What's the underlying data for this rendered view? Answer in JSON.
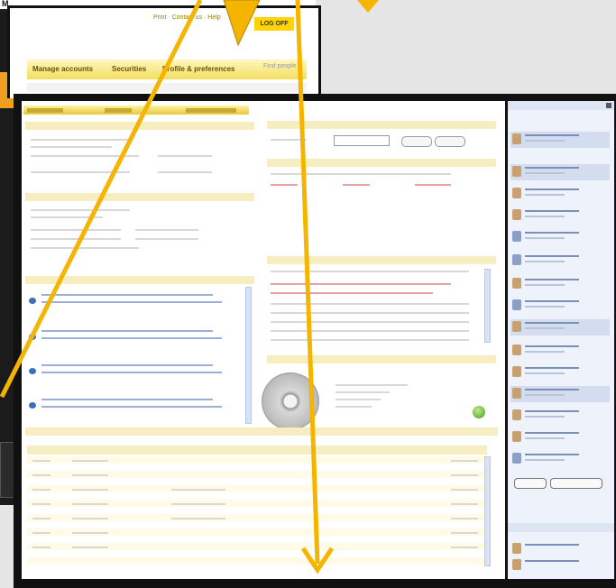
{
  "back_window": {
    "top_label": "M",
    "header_links": "Print  ·  Contact us  ·  Help",
    "logoff_label": "LOG OFF",
    "nav_tabs": [
      "Manage accounts",
      "Securities",
      "Profile & preferences"
    ],
    "search_placeholder": "Find people"
  },
  "colors": {
    "arrow": "#f5b400",
    "accent_yellow": "#ffd400",
    "link_blue": "#3c6fb8",
    "alert_red": "#d03030"
  },
  "icons": [
    "disc-icon",
    "status-check-icon",
    "avatar-icon",
    "close-icon"
  ]
}
